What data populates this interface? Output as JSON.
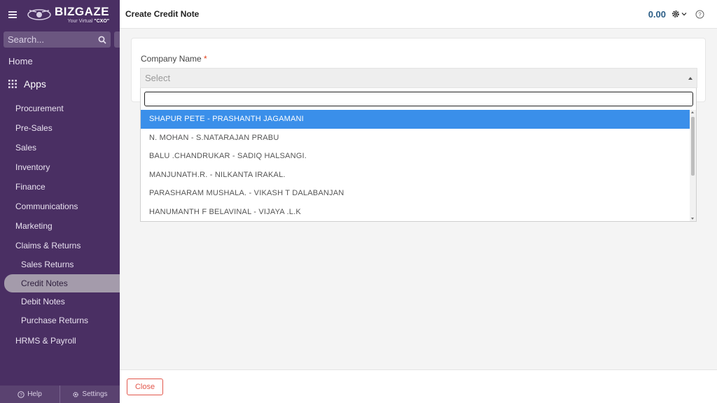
{
  "app": {
    "brand": "BIZGAZE",
    "tagline_prefix": "Your Virtual ",
    "tagline_bold": "\"CXO\""
  },
  "sidebar": {
    "search_placeholder": "Search...",
    "home_label": "Home",
    "apps_label": "Apps",
    "items": [
      {
        "label": "Procurement"
      },
      {
        "label": "Pre-Sales"
      },
      {
        "label": "Sales"
      },
      {
        "label": "Inventory"
      },
      {
        "label": "Finance"
      },
      {
        "label": "Communications"
      },
      {
        "label": "Marketing"
      },
      {
        "label": "Claims & Returns"
      }
    ],
    "sub_items": [
      {
        "label": "Sales Returns"
      },
      {
        "label": "Credit Notes",
        "active": true
      },
      {
        "label": "Debit Notes"
      },
      {
        "label": "Purchase Returns"
      }
    ],
    "hrms_label": "HRMS & Payroll",
    "footer": {
      "help_label": "Help",
      "settings_label": "Settings"
    }
  },
  "header": {
    "title": "Create Credit Note",
    "amount": "0.00"
  },
  "form": {
    "company_label": "Company Name",
    "required_mark": "*",
    "select_placeholder": "Select"
  },
  "dropdown": {
    "search_value": "",
    "options": [
      "SHAPUR PETE - PRASHANTH JAGAMANI",
      "N. MOHAN - S.NATARAJAN PRABU",
      "BALU .CHANDRUKAR - SADIQ HALSANGI.",
      "MANJUNATH.R. - NILKANTA IRAKAL.",
      "PARASHARAM MUSHALA. - VIKASH T DALABANJAN",
      "HANUMANTH F BELAVINAL - VIJAYA .L.K"
    ],
    "highlighted_index": 0
  },
  "footer": {
    "close_label": "Close"
  },
  "colors": {
    "sidebar_bg": "#4a2f63",
    "highlight": "#3a8fea",
    "amount": "#2b5d86",
    "close": "#e2574c"
  }
}
